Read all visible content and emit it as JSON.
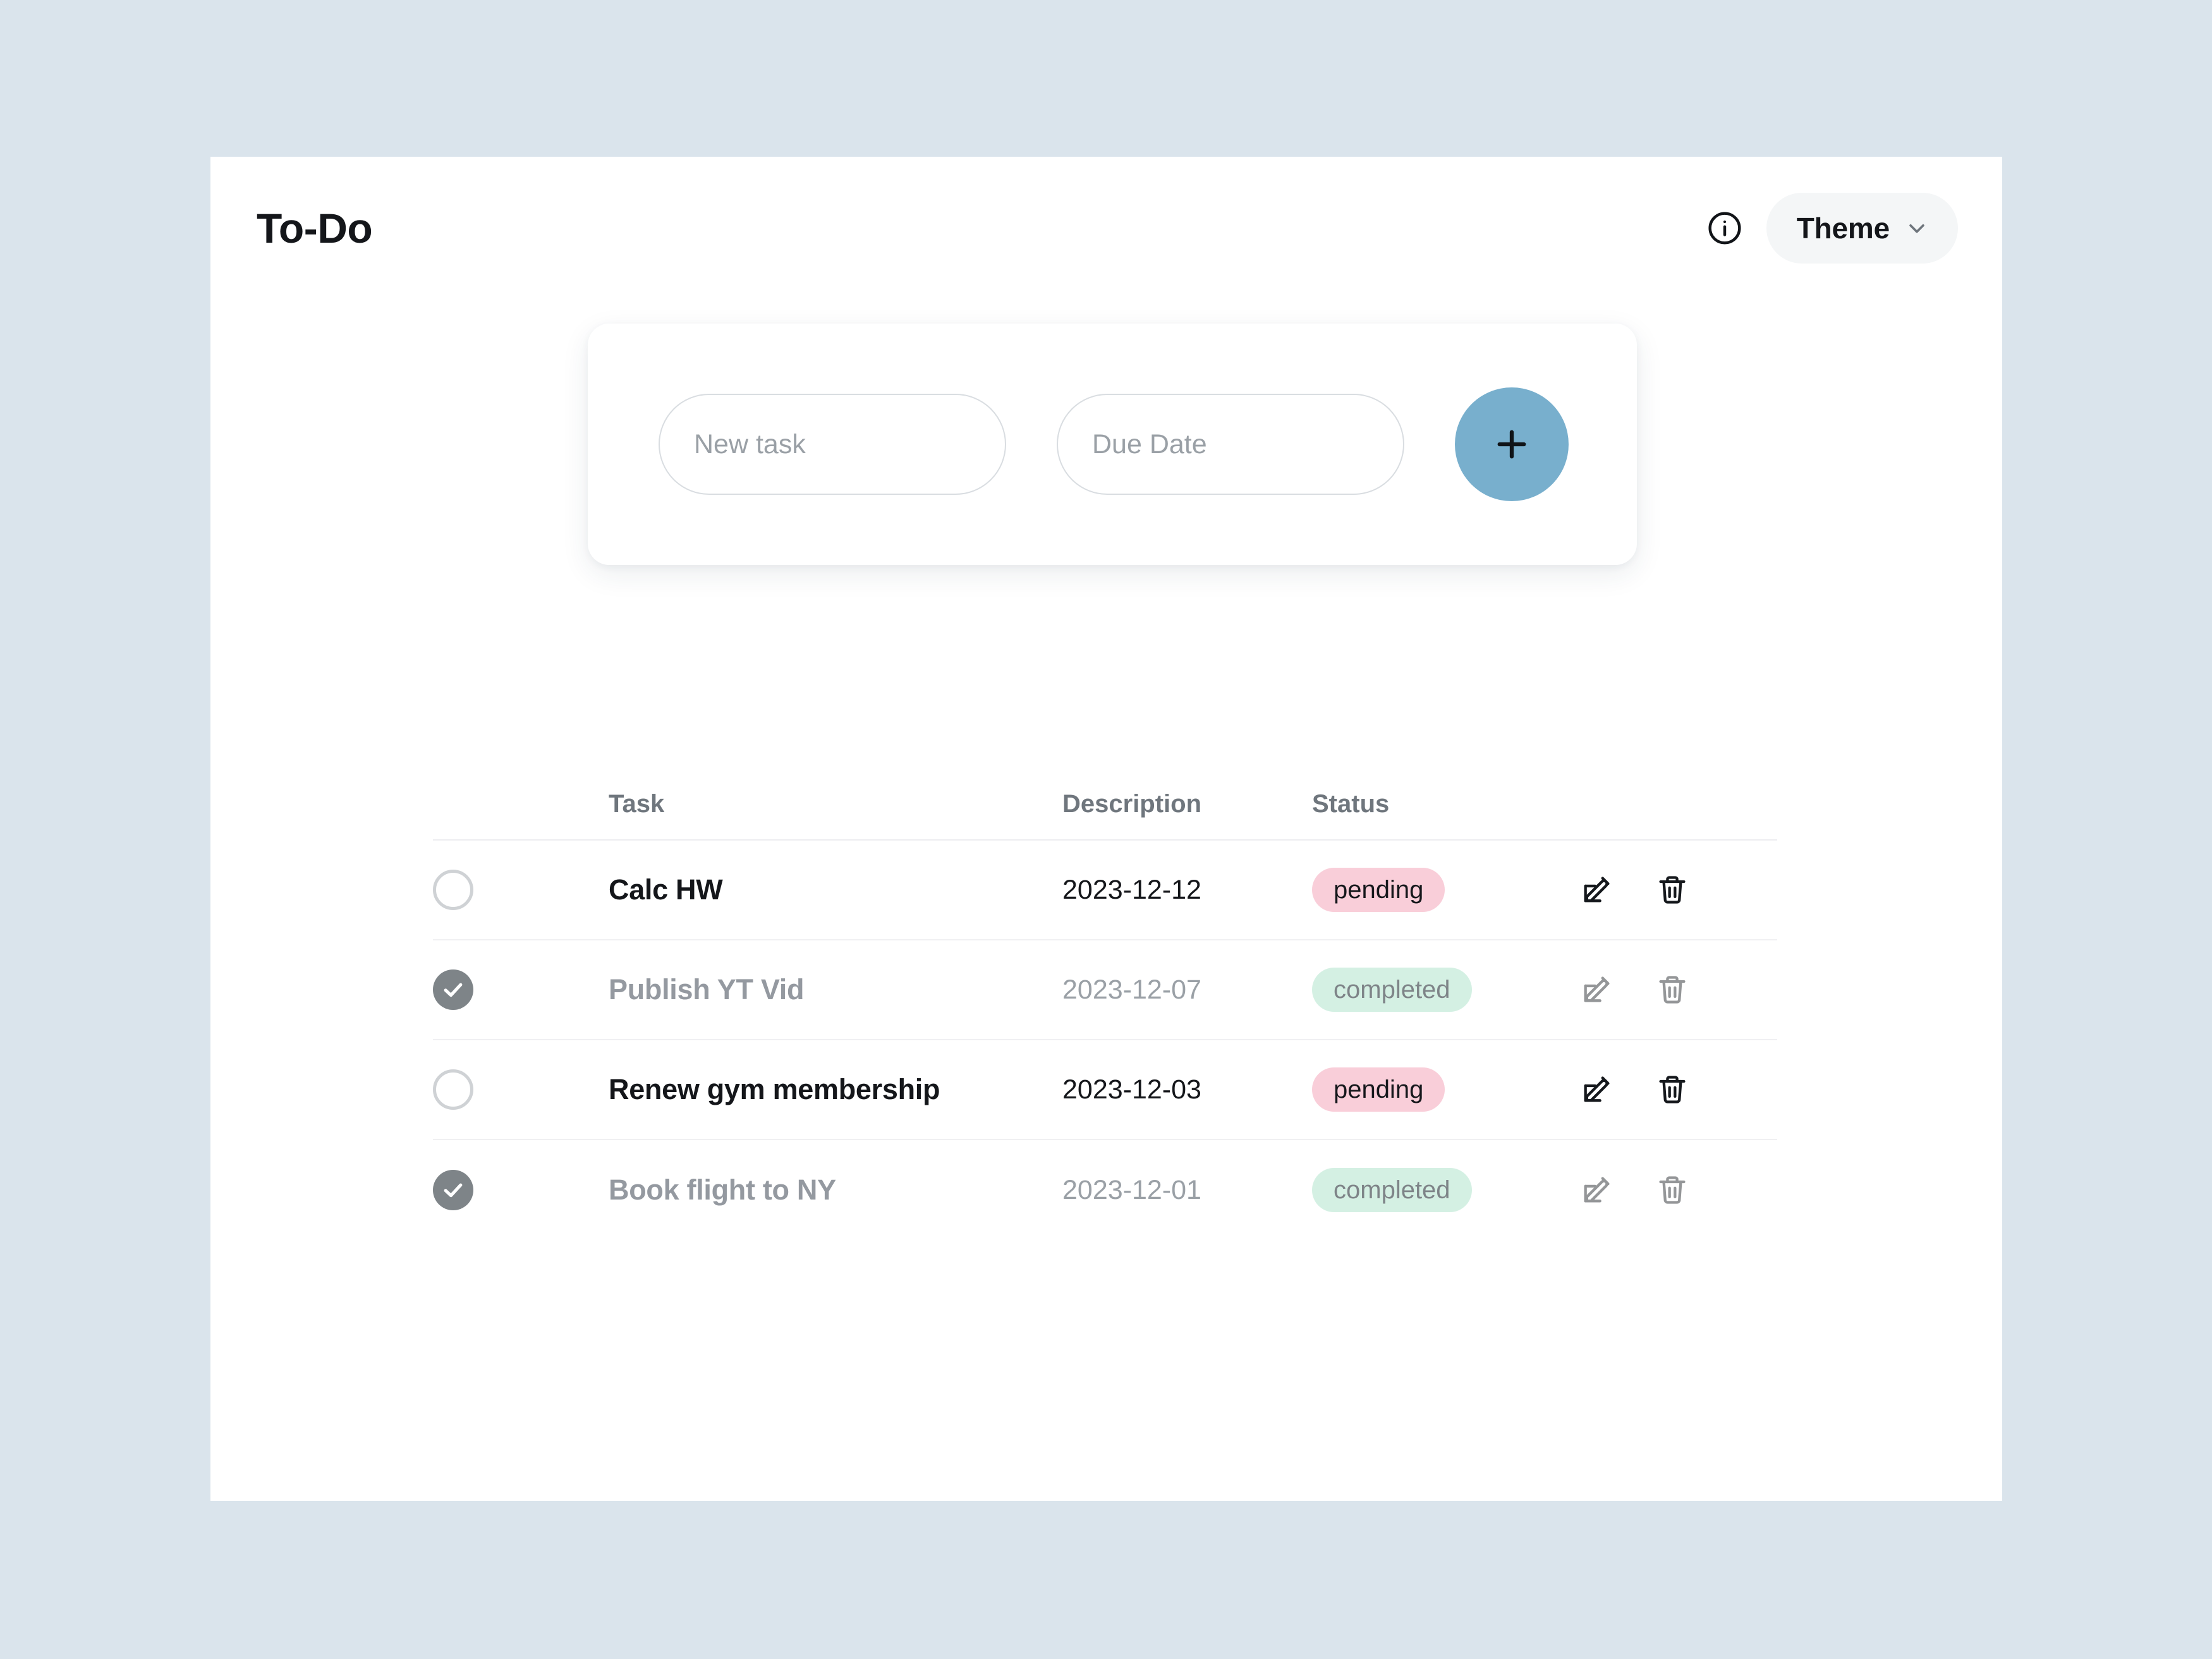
{
  "header": {
    "title": "To-Do",
    "info_icon": "info-circle-icon",
    "theme_label": "Theme",
    "chevron_icon": "chevron-down-icon"
  },
  "composer": {
    "task_value": "",
    "task_placeholder": "New task",
    "date_value": "",
    "date_placeholder": "Due Date",
    "add_icon": "plus-icon"
  },
  "table": {
    "columns": {
      "check": "",
      "task": "Task",
      "description": "Description",
      "status": "Status",
      "actions": ""
    },
    "rows": [
      {
        "task": "Calc HW",
        "description": "2023-12-12",
        "status": "pending",
        "done": false,
        "edit_icon": "edit-pencil-icon",
        "delete_icon": "trash-icon"
      },
      {
        "task": "Publish YT Vid",
        "description": "2023-12-07",
        "status": "completed",
        "done": true,
        "edit_icon": "edit-pencil-icon",
        "delete_icon": "trash-icon"
      },
      {
        "task": "Renew gym membership",
        "description": "2023-12-03",
        "status": "pending",
        "done": false,
        "edit_icon": "edit-pencil-icon",
        "delete_icon": "trash-icon"
      },
      {
        "task": "Book flight to NY",
        "description": "2023-12-01",
        "status": "completed",
        "done": true,
        "edit_icon": "edit-pencil-icon",
        "delete_icon": "trash-icon"
      }
    ]
  },
  "colors": {
    "page_background": "#dae4ec",
    "panel_background": "#ffffff",
    "accent_blue": "#78afcd",
    "pending_badge": "#f9ced9",
    "completed_badge": "#d4f0e3",
    "checked_circle": "#7e8488",
    "theme_pill": "#f4f6f7",
    "muted_text": "#9499a0"
  }
}
